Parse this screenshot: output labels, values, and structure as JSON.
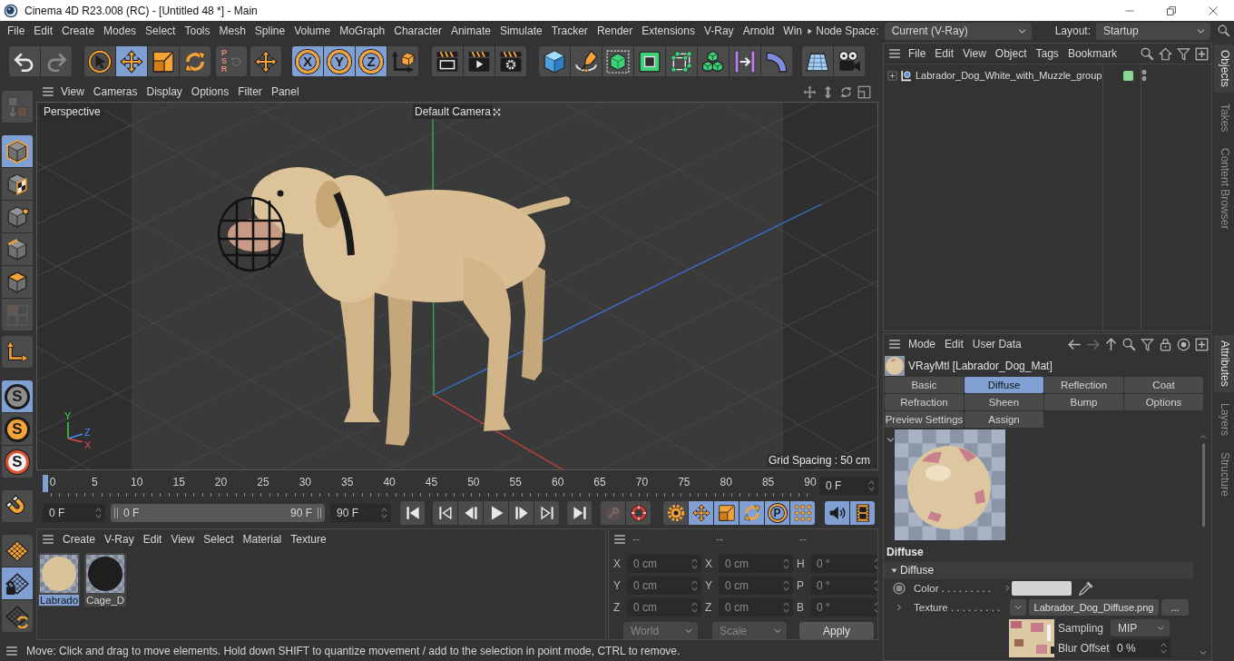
{
  "window": {
    "title": "Cinema 4D R23.008 (RC) - [Untitled 48 *] - Main"
  },
  "menu_bar": {
    "items": [
      "File",
      "Edit",
      "Create",
      "Modes",
      "Select",
      "Tools",
      "Mesh",
      "Spline",
      "Volume",
      "MoGraph",
      "Character",
      "Animate",
      "Simulate",
      "Tracker",
      "Render",
      "Extensions",
      "V-Ray",
      "Arnold",
      "Win"
    ],
    "node_space": {
      "label": "Node Space:",
      "value": "Current (V-Ray)"
    },
    "layout": {
      "label": "Layout:",
      "value": "Startup"
    }
  },
  "main_toolbar": {
    "groups": [
      [
        {
          "selected": false,
          "disabled": false
        },
        {
          "selected": false,
          "disabled": true
        }
      ],
      [
        {
          "selected": false,
          "disabled": false
        },
        {
          "selected": true,
          "disabled": false
        },
        {
          "selected": false,
          "disabled": false
        },
        {
          "selected": false,
          "disabled": false
        }
      ],
      [
        {
          "label": "PSR",
          "selected": false,
          "disabled": true
        }
      ],
      [
        {
          "selected": false,
          "disabled": false
        }
      ],
      [
        {
          "label": "X",
          "selected": true,
          "disabled": false
        },
        {
          "label": "Y",
          "selected": true,
          "disabled": false
        },
        {
          "label": "Z",
          "selected": true,
          "disabled": false
        },
        {
          "selected": false,
          "disabled": false
        }
      ],
      [
        {
          "selected": false,
          "disabled": false
        },
        {
          "selected": false,
          "disabled": false
        },
        {
          "selected": false,
          "disabled": false
        }
      ],
      [
        {
          "selected": false,
          "disabled": false
        },
        {
          "selected": false,
          "disabled": false
        },
        {
          "selected": false,
          "disabled": false
        },
        {
          "selected": false,
          "disabled": false
        },
        {
          "selected": false,
          "disabled": false
        },
        {
          "selected": false,
          "disabled": false
        },
        {
          "selected": false,
          "disabled": false
        },
        {
          "selected": false,
          "disabled": false
        }
      ],
      [
        {
          "selected": false,
          "disabled": false
        },
        {
          "selected": false,
          "disabled": false
        }
      ]
    ]
  },
  "mode_toolbar": {
    "groups": [
      [
        {
          "selected": false,
          "disabled": true
        }
      ],
      [
        {
          "selected": true,
          "disabled": false
        },
        {
          "selected": false,
          "disabled": false
        },
        {
          "selected": false,
          "disabled": false
        },
        {
          "selected": false,
          "disabled": false
        },
        {
          "selected": false,
          "disabled": false
        },
        {
          "selected": false,
          "disabled": true
        }
      ],
      [
        {
          "selected": false,
          "disabled": false
        }
      ],
      [
        {
          "label": "S",
          "selected": true,
          "disabled": false
        },
        {
          "label": "S",
          "selected": false,
          "disabled": false
        },
        {
          "label": "S",
          "selected": false,
          "disabled": false
        }
      ],
      [
        {
          "selected": false,
          "disabled": false
        }
      ],
      [
        {
          "selected": false,
          "disabled": false
        },
        {
          "selected": true,
          "disabled": false
        },
        {
          "selected": false,
          "disabled": false
        }
      ]
    ]
  },
  "viewport": {
    "menu": [
      "View",
      "Cameras",
      "Display",
      "Options",
      "Filter",
      "Panel"
    ],
    "camera_label": "Perspective",
    "active_camera": "Default Camera",
    "grid_spacing": "Grid Spacing : 50 cm",
    "axis_labels": [
      "Y",
      "Z",
      "X"
    ]
  },
  "timeline": {
    "labels": [
      "0",
      "5",
      "10",
      "15",
      "20",
      "25",
      "30",
      "35",
      "40",
      "45",
      "50",
      "55",
      "60",
      "65",
      "70",
      "75",
      "80",
      "85",
      "90"
    ],
    "level": 0,
    "current_frame": "0 F"
  },
  "transport": {
    "start_frame": "0 F",
    "preview_range": {
      "start": "0 F",
      "end": "90 F",
      "level": 1
    },
    "end_frame": "90 F",
    "groups": [
      [
        {
          "selected": false,
          "disabled": false
        }
      ],
      [
        {
          "selected": false,
          "disabled": false
        },
        {
          "selected": false,
          "disabled": false
        },
        {
          "selected": false,
          "disabled": false
        },
        {
          "selected": false,
          "disabled": false
        },
        {
          "selected": false,
          "disabled": false
        }
      ],
      [
        {
          "selected": false,
          "disabled": false
        }
      ],
      [
        {
          "selected": false,
          "disabled": true
        },
        {
          "selected": false,
          "disabled": false
        }
      ],
      [
        {
          "selected": false,
          "disabled": false
        },
        {
          "selected": true,
          "disabled": false
        },
        {
          "selected": true,
          "disabled": false
        },
        {
          "selected": true,
          "disabled": false
        },
        {
          "label": "P",
          "selected": true,
          "disabled": false
        },
        {
          "selected": true,
          "disabled": false
        }
      ],
      [
        {
          "selected": true,
          "disabled": false
        },
        {
          "selected": true,
          "disabled": false
        }
      ]
    ]
  },
  "material_manager": {
    "menu": [
      "Create",
      "V-Ray",
      "Edit",
      "View",
      "Select",
      "Material",
      "Texture"
    ],
    "materials": [
      {
        "name": "Labrado",
        "selected": true,
        "color": "#d8c39b"
      },
      {
        "name": "Cage_D",
        "selected": false,
        "color": "#1e1e1e"
      }
    ]
  },
  "coordinates": {
    "headers": [
      "--",
      "--",
      "--"
    ],
    "disabled": true,
    "rows": [
      [
        {
          "label": "X",
          "value": "0 cm"
        },
        {
          "label": "X",
          "value": "0 cm"
        },
        {
          "label": "H",
          "value": "0 °"
        }
      ],
      [
        {
          "label": "Y",
          "value": "0 cm"
        },
        {
          "label": "Y",
          "value": "0 cm"
        },
        {
          "label": "P",
          "value": "0 °"
        }
      ],
      [
        {
          "label": "Z",
          "value": "0 cm"
        },
        {
          "label": "Z",
          "value": "0 cm"
        },
        {
          "label": "B",
          "value": "0 °"
        }
      ]
    ],
    "dropdowns": [
      "World",
      "Scale"
    ],
    "apply": "Apply"
  },
  "status_bar": {
    "text": "Move: Click and drag to move elements. Hold down SHIFT to quantize movement / add to the selection in point mode, CTRL to remove."
  },
  "objects_manager": {
    "menu": [
      "File",
      "Edit",
      "View",
      "Object",
      "Tags",
      "Bookmark"
    ],
    "objects": [
      {
        "name": "Labrador_Dog_White_with_Muzzle_group",
        "expanded": false,
        "color": "#88d894"
      }
    ]
  },
  "objects_tabs": [
    {
      "label": "Objects",
      "selected": true
    },
    {
      "label": "Takes",
      "selected": false
    },
    {
      "label": "Content Browser",
      "selected": false
    }
  ],
  "attributes": {
    "menu": [
      "Mode",
      "Edit",
      "User Data"
    ],
    "title": "VRayMtl [Labrador_Dog_Mat]",
    "tabs": [
      {
        "label": "Basic",
        "selected": false
      },
      {
        "label": "Diffuse",
        "selected": true
      },
      {
        "label": "Reflection",
        "selected": false
      },
      {
        "label": "Coat",
        "selected": false
      },
      {
        "label": "Refraction",
        "selected": false
      },
      {
        "label": "Sheen",
        "selected": false
      },
      {
        "label": "Bump",
        "selected": false
      },
      {
        "label": "Options",
        "selected": false
      },
      {
        "label": "Preview Settings",
        "selected": false
      },
      {
        "label": "Assign",
        "selected": false
      }
    ],
    "section_title": "Diffuse",
    "group": {
      "label": "Diffuse",
      "expanded": true
    },
    "color_param": {
      "label": "Color . . . . . . . . .",
      "color": "#d4d4d4"
    },
    "texture_param": {
      "label": "Texture . . . . . . . . .",
      "expanded": false,
      "file": "Labrador_Dog_Diffuse.png",
      "browse": "..."
    },
    "sampling": {
      "label": "Sampling",
      "value": "MIP"
    },
    "blur_offset": {
      "label": "Blur Offset",
      "value": "0 %"
    }
  },
  "attributes_tabs": [
    {
      "label": "Attributes",
      "selected": true
    },
    {
      "label": "Layers",
      "selected": false
    },
    {
      "label": "Structure",
      "selected": false
    }
  ]
}
